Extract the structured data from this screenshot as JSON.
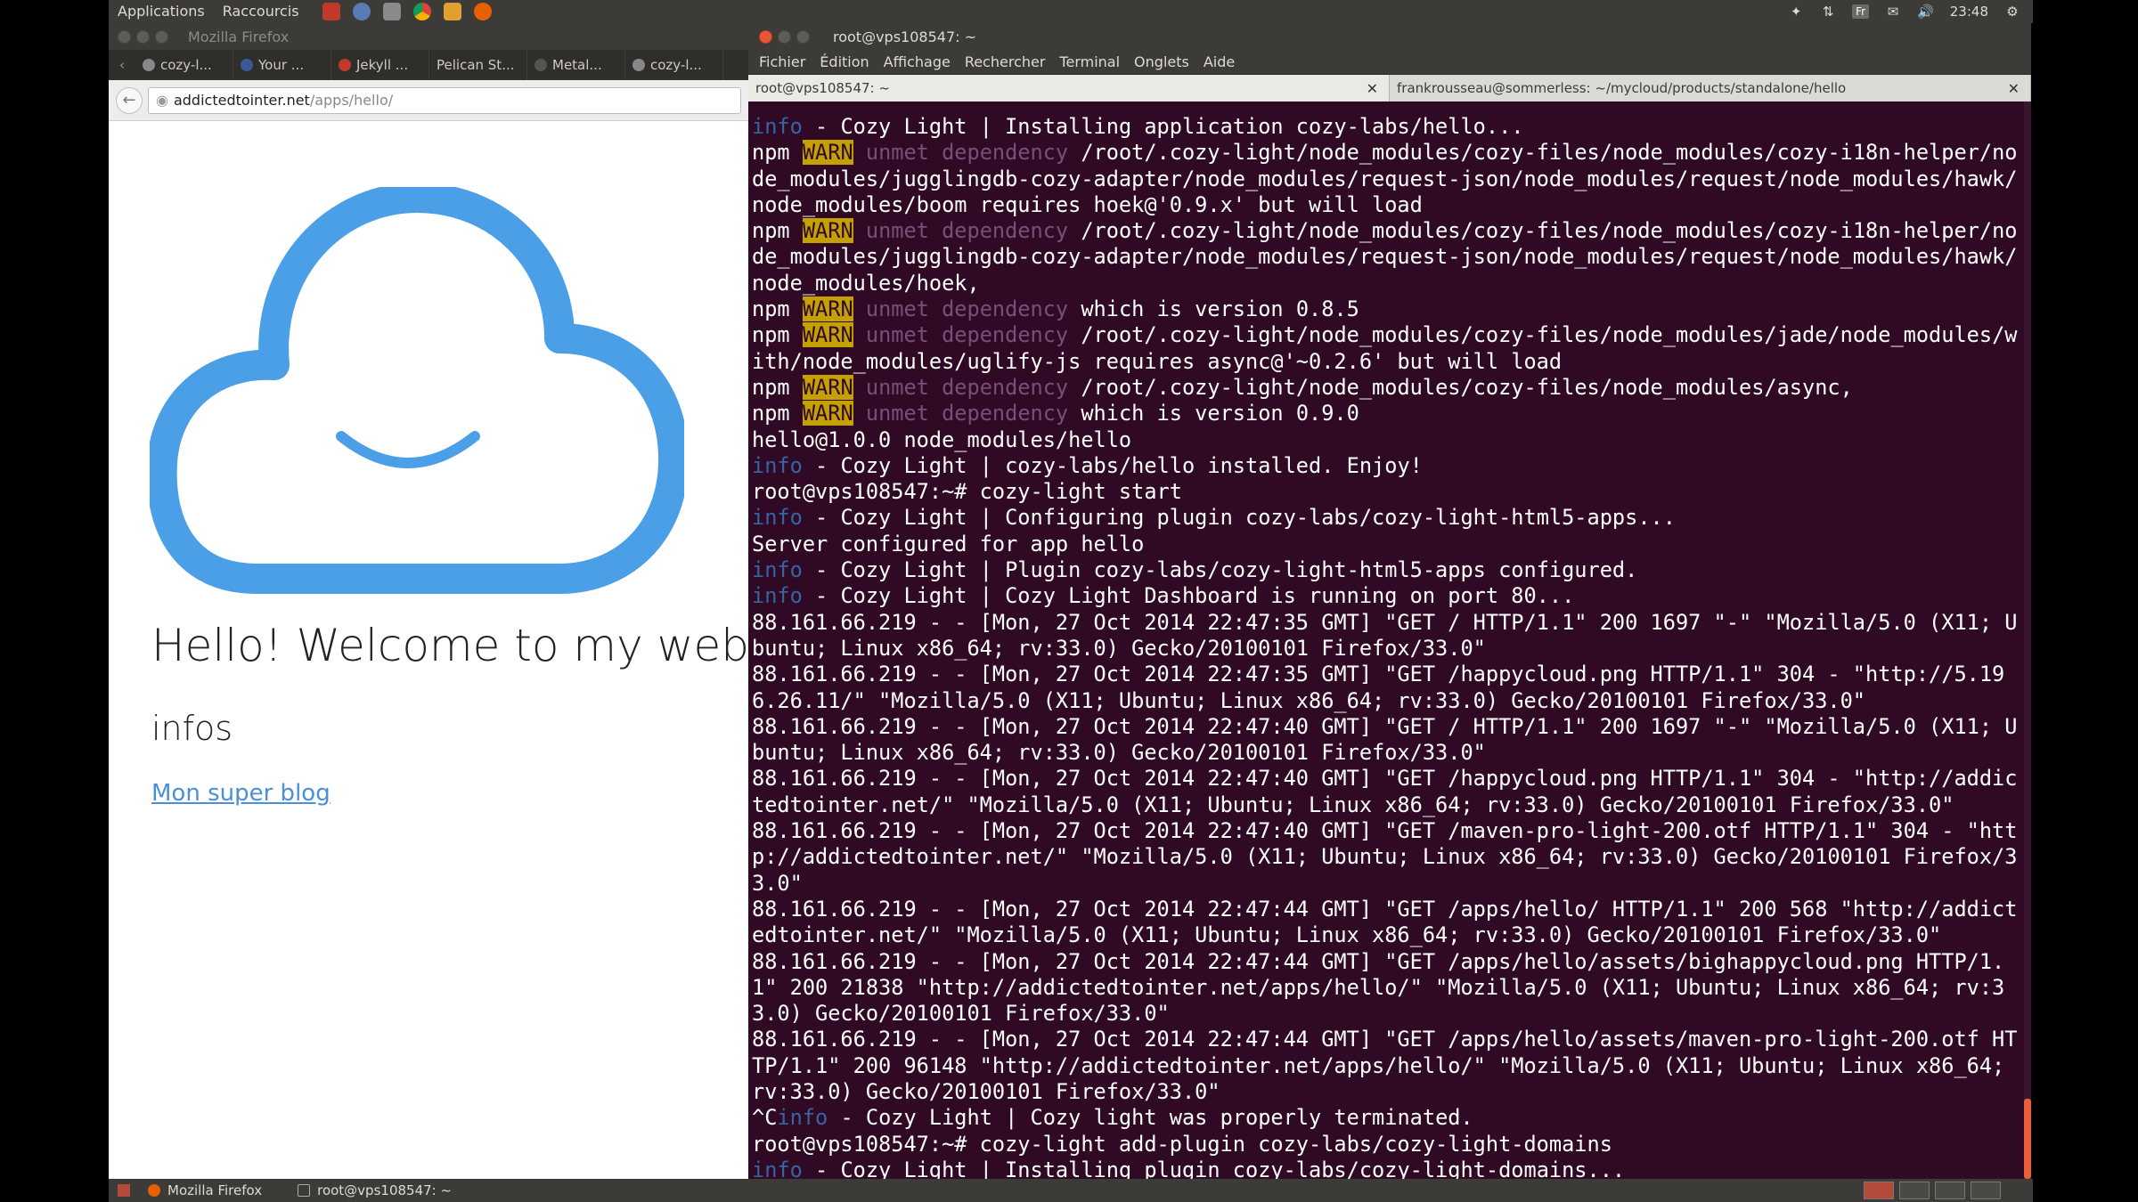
{
  "top_panel": {
    "menu_applications": "Applications",
    "menu_shortcuts": "Raccourcis",
    "lang": "Fr",
    "clock": "23:48"
  },
  "firefox": {
    "window_title": "Mozilla Firefox",
    "tabs": [
      "cozy-l...",
      "Your ...",
      "Jekyll ...",
      "Pelican St...",
      "Metal...",
      "cozy-l..."
    ],
    "url_host": "addictedtointer.net",
    "url_path": "/apps/hello/",
    "page": {
      "heading": "Hello! Welcome to my web",
      "subheading": "infos",
      "link": "Mon super blog"
    }
  },
  "terminal": {
    "window_title": "root@vps108547: ~",
    "menus": [
      "Fichier",
      "Édition",
      "Affichage",
      "Rechercher",
      "Terminal",
      "Onglets",
      "Aide"
    ],
    "tabs": [
      "root@vps108547: ~",
      "frankrousseau@sommerless: ~/mycloud/products/standalone/hello"
    ],
    "lines": [
      {
        "segs": [
          {
            "t": "info",
            "c": "info"
          },
          {
            "t": " - Cozy Light | Installing application cozy-labs/hello..."
          }
        ]
      },
      {
        "segs": [
          {
            "t": "npm "
          },
          {
            "t": "WARN",
            "c": "warn"
          },
          {
            "t": " unmet dependency",
            "c": "dim"
          },
          {
            "t": " /root/.cozy-light/node_modules/cozy-files/node_modules/cozy-i18n-helper/node_modules/jugglingdb-cozy-adapter/node_modules/request-json/node_modules/request/node_modules/hawk/node_modules/boom requires hoek@'0.9.x' but will load"
          }
        ]
      },
      {
        "segs": [
          {
            "t": "npm "
          },
          {
            "t": "WARN",
            "c": "warn"
          },
          {
            "t": " unmet dependency",
            "c": "dim"
          },
          {
            "t": " /root/.cozy-light/node_modules/cozy-files/node_modules/cozy-i18n-helper/node_modules/jugglingdb-cozy-adapter/node_modules/request-json/node_modules/request/node_modules/hawk/node_modules/hoek,"
          }
        ]
      },
      {
        "segs": [
          {
            "t": "npm "
          },
          {
            "t": "WARN",
            "c": "warn"
          },
          {
            "t": " unmet dependency",
            "c": "dim"
          },
          {
            "t": " which is version 0.8.5"
          }
        ]
      },
      {
        "segs": [
          {
            "t": "npm "
          },
          {
            "t": "WARN",
            "c": "warn"
          },
          {
            "t": " unmet dependency",
            "c": "dim"
          },
          {
            "t": " /root/.cozy-light/node_modules/cozy-files/node_modules/jade/node_modules/with/node_modules/uglify-js requires async@'~0.2.6' but will load"
          }
        ]
      },
      {
        "segs": [
          {
            "t": "npm "
          },
          {
            "t": "WARN",
            "c": "warn"
          },
          {
            "t": " unmet dependency",
            "c": "dim"
          },
          {
            "t": " /root/.cozy-light/node_modules/cozy-files/node_modules/async,"
          }
        ]
      },
      {
        "segs": [
          {
            "t": "npm "
          },
          {
            "t": "WARN",
            "c": "warn"
          },
          {
            "t": " unmet dependency",
            "c": "dim"
          },
          {
            "t": " which is version 0.9.0"
          }
        ]
      },
      {
        "segs": [
          {
            "t": "hello@1.0.0 node_modules/hello"
          }
        ]
      },
      {
        "segs": [
          {
            "t": "info",
            "c": "info"
          },
          {
            "t": " - Cozy Light | cozy-labs/hello installed. Enjoy!"
          }
        ]
      },
      {
        "segs": [
          {
            "t": "root@vps108547:~# cozy-light start"
          }
        ]
      },
      {
        "segs": [
          {
            "t": "info",
            "c": "info"
          },
          {
            "t": " - Cozy Light | Configuring plugin cozy-labs/cozy-light-html5-apps..."
          }
        ]
      },
      {
        "segs": [
          {
            "t": "Server configured for app hello"
          }
        ]
      },
      {
        "segs": [
          {
            "t": "info",
            "c": "info"
          },
          {
            "t": " - Cozy Light | Plugin cozy-labs/cozy-light-html5-apps configured."
          }
        ]
      },
      {
        "segs": [
          {
            "t": "info",
            "c": "info"
          },
          {
            "t": " - Cozy Light | Cozy Light Dashboard is running on port 80..."
          }
        ]
      },
      {
        "segs": [
          {
            "t": "88.161.66.219 - - [Mon, 27 Oct 2014 22:47:35 GMT] \"GET / HTTP/1.1\" 200 1697 \"-\" \"Mozilla/5.0 (X11; Ubuntu; Linux x86_64; rv:33.0) Gecko/20100101 Firefox/33.0\""
          }
        ]
      },
      {
        "segs": [
          {
            "t": "88.161.66.219 - - [Mon, 27 Oct 2014 22:47:35 GMT] \"GET /happycloud.png HTTP/1.1\" 304 - \"http://5.196.26.11/\" \"Mozilla/5.0 (X11; Ubuntu; Linux x86_64; rv:33.0) Gecko/20100101 Firefox/33.0\""
          }
        ]
      },
      {
        "segs": [
          {
            "t": "88.161.66.219 - - [Mon, 27 Oct 2014 22:47:40 GMT] \"GET / HTTP/1.1\" 200 1697 \"-\" \"Mozilla/5.0 (X11; Ubuntu; Linux x86_64; rv:33.0) Gecko/20100101 Firefox/33.0\""
          }
        ]
      },
      {
        "segs": [
          {
            "t": "88.161.66.219 - - [Mon, 27 Oct 2014 22:47:40 GMT] \"GET /happycloud.png HTTP/1.1\" 304 - \"http://addictedtointer.net/\" \"Mozilla/5.0 (X11; Ubuntu; Linux x86_64; rv:33.0) Gecko/20100101 Firefox/33.0\""
          }
        ]
      },
      {
        "segs": [
          {
            "t": "88.161.66.219 - - [Mon, 27 Oct 2014 22:47:40 GMT] \"GET /maven-pro-light-200.otf HTTP/1.1\" 304 - \"http://addictedtointer.net/\" \"Mozilla/5.0 (X11; Ubuntu; Linux x86_64; rv:33.0) Gecko/20100101 Firefox/33.0\""
          }
        ]
      },
      {
        "segs": [
          {
            "t": "88.161.66.219 - - [Mon, 27 Oct 2014 22:47:44 GMT] \"GET /apps/hello/ HTTP/1.1\" 200 568 \"http://addictedtointer.net/\" \"Mozilla/5.0 (X11; Ubuntu; Linux x86_64; rv:33.0) Gecko/20100101 Firefox/33.0\""
          }
        ]
      },
      {
        "segs": [
          {
            "t": "88.161.66.219 - - [Mon, 27 Oct 2014 22:47:44 GMT] \"GET /apps/hello/assets/bighappycloud.png HTTP/1.1\" 200 21838 \"http://addictedtointer.net/apps/hello/\" \"Mozilla/5.0 (X11; Ubuntu; Linux x86_64; rv:33.0) Gecko/20100101 Firefox/33.0\""
          }
        ]
      },
      {
        "segs": [
          {
            "t": "88.161.66.219 - - [Mon, 27 Oct 2014 22:47:44 GMT] \"GET /apps/hello/assets/maven-pro-light-200.otf HTTP/1.1\" 200 96148 \"http://addictedtointer.net/apps/hello/\" \"Mozilla/5.0 (X11; Ubuntu; Linux x86_64; rv:33.0) Gecko/20100101 Firefox/33.0\""
          }
        ]
      },
      {
        "segs": [
          {
            "t": "^C"
          },
          {
            "t": "info",
            "c": "info"
          },
          {
            "t": " - Cozy Light | Cozy light was properly terminated."
          }
        ]
      },
      {
        "segs": [
          {
            "t": "root@vps108547:~# cozy-light add-plugin cozy-labs/cozy-light-domains"
          }
        ]
      },
      {
        "segs": [
          {
            "t": "info",
            "c": "info"
          },
          {
            "t": " - Cozy Light | Installing plugin cozy-labs/cozy-light-domains..."
          }
        ]
      },
      {
        "segs": [
          {
            "t": "/",
            "c": "cursor"
          }
        ]
      }
    ]
  },
  "bottom_panel": {
    "task_firefox": "Mozilla Firefox",
    "task_terminal": "root@vps108547: ~"
  },
  "colors": {
    "terminal_bg": "#300a24",
    "info": "#3465a4",
    "warn_bg": "#c4a000",
    "dim": "#75507b",
    "cloud_blue": "#4a9fe6",
    "panel": "#3c3b37"
  }
}
